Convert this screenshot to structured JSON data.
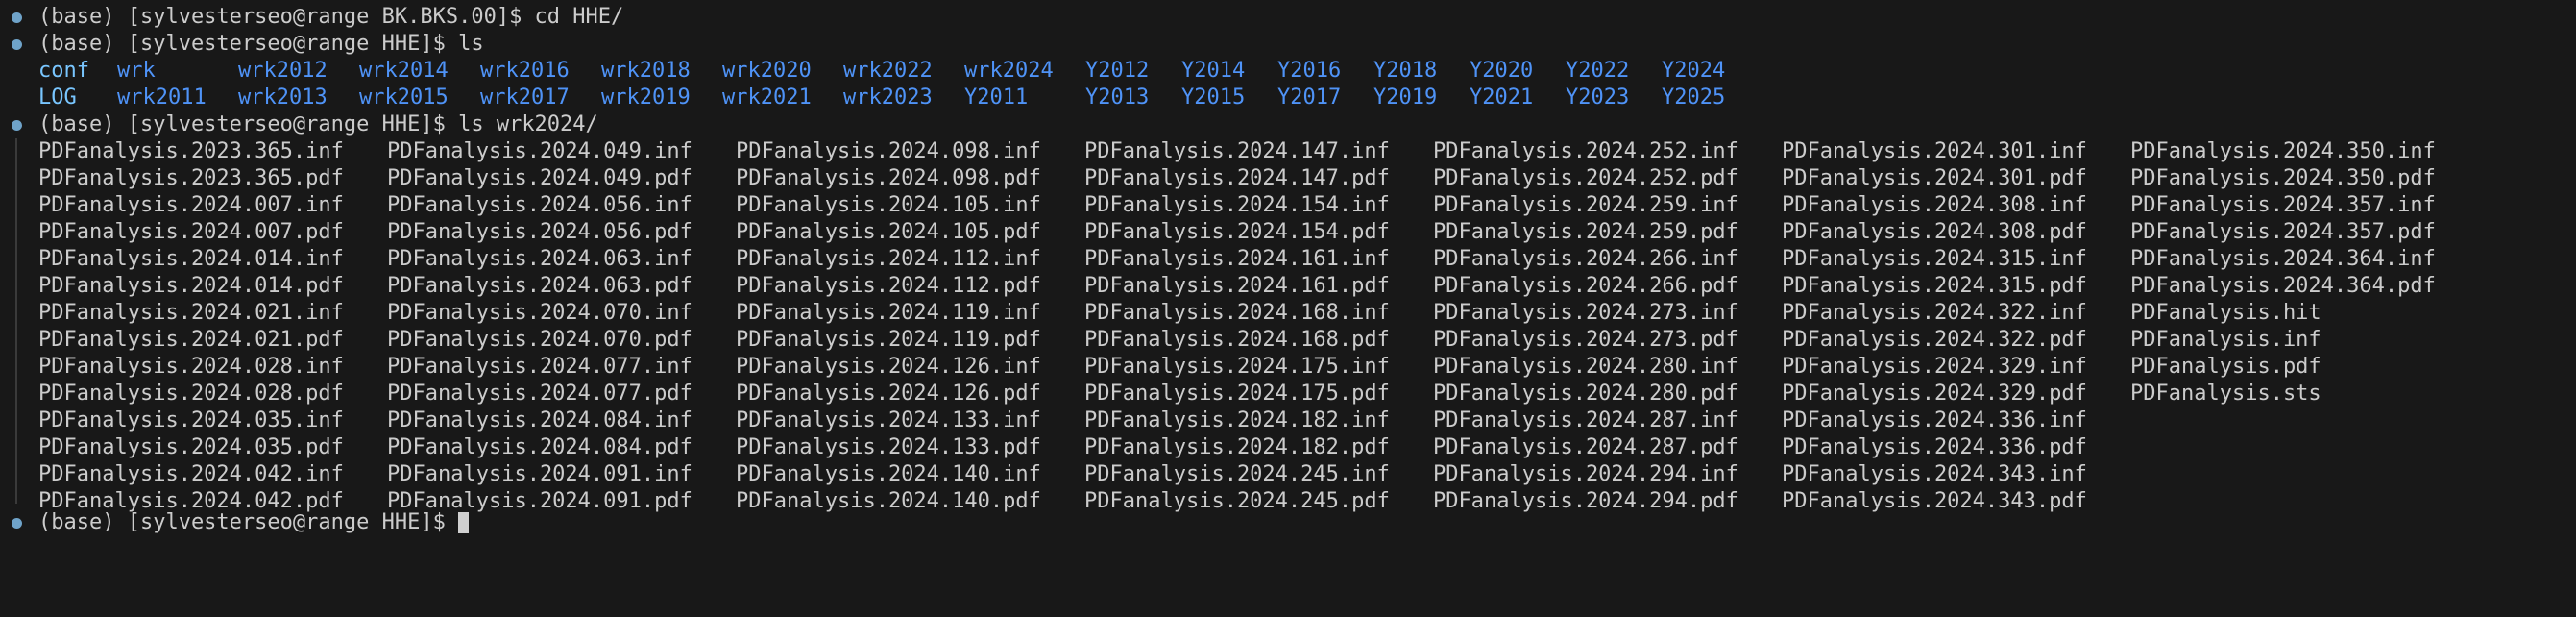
{
  "prompts": {
    "p1": "(base) [sylvesterseo@range BK.BKS.00]$ cd HHE/",
    "p2": "(base) [sylvesterseo@range HHE]$ ls",
    "p3": "(base) [sylvesterseo@range HHE]$ ls wrk2024/",
    "p4": "(base) [sylvesterseo@range HHE]$ "
  },
  "ls_row1": [
    "conf",
    "wrk",
    "wrk2012",
    "wrk2014",
    "wrk2016",
    "wrk2018",
    "wrk2020",
    "wrk2022",
    "wrk2024",
    "Y2012",
    "Y2014",
    "Y2016",
    "Y2018",
    "Y2020",
    "Y2022",
    "Y2024"
  ],
  "ls_row2": [
    "LOG",
    "wrk2011",
    "wrk2013",
    "wrk2015",
    "wrk2017",
    "wrk2019",
    "wrk2021",
    "wrk2023",
    "Y2011",
    "Y2013",
    "Y2015",
    "Y2017",
    "Y2019",
    "Y2021",
    "Y2023",
    "Y2025"
  ],
  "files": [
    [
      "PDFanalysis.2023.365.inf",
      "PDFanalysis.2024.049.inf",
      "PDFanalysis.2024.098.inf",
      "PDFanalysis.2024.147.inf",
      "PDFanalysis.2024.252.inf",
      "PDFanalysis.2024.301.inf",
      "PDFanalysis.2024.350.inf"
    ],
    [
      "PDFanalysis.2023.365.pdf",
      "PDFanalysis.2024.049.pdf",
      "PDFanalysis.2024.098.pdf",
      "PDFanalysis.2024.147.pdf",
      "PDFanalysis.2024.252.pdf",
      "PDFanalysis.2024.301.pdf",
      "PDFanalysis.2024.350.pdf"
    ],
    [
      "PDFanalysis.2024.007.inf",
      "PDFanalysis.2024.056.inf",
      "PDFanalysis.2024.105.inf",
      "PDFanalysis.2024.154.inf",
      "PDFanalysis.2024.259.inf",
      "PDFanalysis.2024.308.inf",
      "PDFanalysis.2024.357.inf"
    ],
    [
      "PDFanalysis.2024.007.pdf",
      "PDFanalysis.2024.056.pdf",
      "PDFanalysis.2024.105.pdf",
      "PDFanalysis.2024.154.pdf",
      "PDFanalysis.2024.259.pdf",
      "PDFanalysis.2024.308.pdf",
      "PDFanalysis.2024.357.pdf"
    ],
    [
      "PDFanalysis.2024.014.inf",
      "PDFanalysis.2024.063.inf",
      "PDFanalysis.2024.112.inf",
      "PDFanalysis.2024.161.inf",
      "PDFanalysis.2024.266.inf",
      "PDFanalysis.2024.315.inf",
      "PDFanalysis.2024.364.inf"
    ],
    [
      "PDFanalysis.2024.014.pdf",
      "PDFanalysis.2024.063.pdf",
      "PDFanalysis.2024.112.pdf",
      "PDFanalysis.2024.161.pdf",
      "PDFanalysis.2024.266.pdf",
      "PDFanalysis.2024.315.pdf",
      "PDFanalysis.2024.364.pdf"
    ],
    [
      "PDFanalysis.2024.021.inf",
      "PDFanalysis.2024.070.inf",
      "PDFanalysis.2024.119.inf",
      "PDFanalysis.2024.168.inf",
      "PDFanalysis.2024.273.inf",
      "PDFanalysis.2024.322.inf",
      "PDFanalysis.hit"
    ],
    [
      "PDFanalysis.2024.021.pdf",
      "PDFanalysis.2024.070.pdf",
      "PDFanalysis.2024.119.pdf",
      "PDFanalysis.2024.168.pdf",
      "PDFanalysis.2024.273.pdf",
      "PDFanalysis.2024.322.pdf",
      "PDFanalysis.inf"
    ],
    [
      "PDFanalysis.2024.028.inf",
      "PDFanalysis.2024.077.inf",
      "PDFanalysis.2024.126.inf",
      "PDFanalysis.2024.175.inf",
      "PDFanalysis.2024.280.inf",
      "PDFanalysis.2024.329.inf",
      "PDFanalysis.pdf"
    ],
    [
      "PDFanalysis.2024.028.pdf",
      "PDFanalysis.2024.077.pdf",
      "PDFanalysis.2024.126.pdf",
      "PDFanalysis.2024.175.pdf",
      "PDFanalysis.2024.280.pdf",
      "PDFanalysis.2024.329.pdf",
      "PDFanalysis.sts"
    ],
    [
      "PDFanalysis.2024.035.inf",
      "PDFanalysis.2024.084.inf",
      "PDFanalysis.2024.133.inf",
      "PDFanalysis.2024.182.inf",
      "PDFanalysis.2024.287.inf",
      "PDFanalysis.2024.336.inf",
      ""
    ],
    [
      "PDFanalysis.2024.035.pdf",
      "PDFanalysis.2024.084.pdf",
      "PDFanalysis.2024.133.pdf",
      "PDFanalysis.2024.182.pdf",
      "PDFanalysis.2024.287.pdf",
      "PDFanalysis.2024.336.pdf",
      ""
    ],
    [
      "PDFanalysis.2024.042.inf",
      "PDFanalysis.2024.091.inf",
      "PDFanalysis.2024.140.inf",
      "PDFanalysis.2024.245.inf",
      "PDFanalysis.2024.294.inf",
      "PDFanalysis.2024.343.inf",
      ""
    ],
    [
      "PDFanalysis.2024.042.pdf",
      "PDFanalysis.2024.091.pdf",
      "PDFanalysis.2024.140.pdf",
      "PDFanalysis.2024.245.pdf",
      "PDFanalysis.2024.294.pdf",
      "PDFanalysis.2024.343.pdf",
      ""
    ]
  ],
  "colors": {
    "background": "#181818",
    "text": "#cccccc",
    "directory": "#4f93f7",
    "prompt_dot": "#6fa3c9"
  }
}
